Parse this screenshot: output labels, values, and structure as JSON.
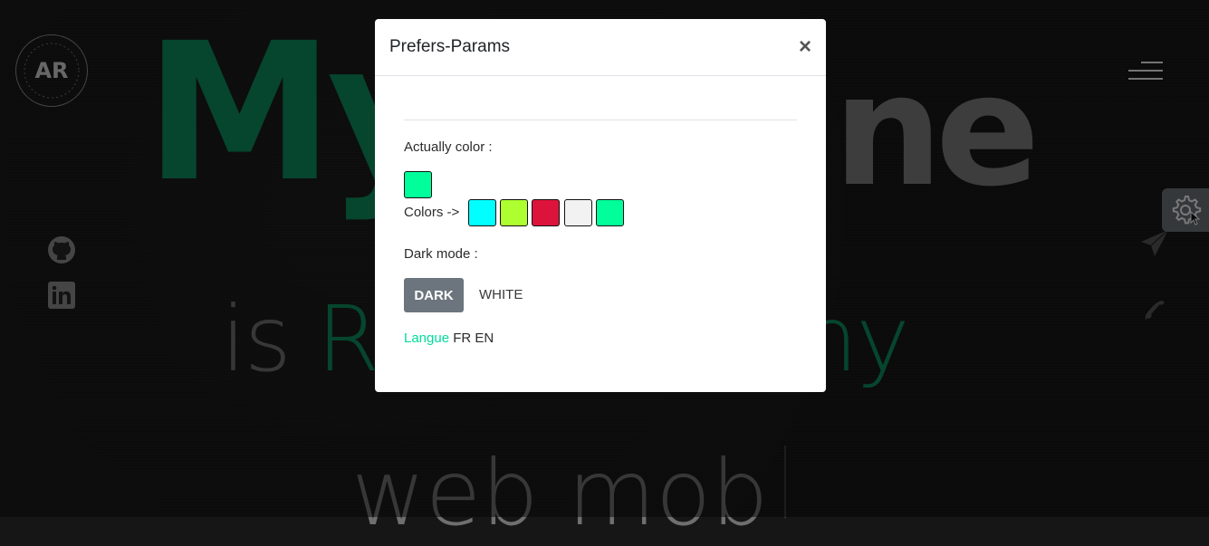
{
  "hero": {
    "line1_colored": "My",
    "line1_gray": "ne",
    "line2_gray": "is ",
    "line2_colored": "R",
    "line2_tail": "ny",
    "line3": "web mob"
  },
  "logo": {
    "initials": "AR"
  },
  "modal": {
    "title": "Prefers-Params",
    "close_symbol": "×",
    "actually_color_label": "Actually color :",
    "current_color": "#00ff9a",
    "colors_label": "Colors ->",
    "colors": [
      "#00ffff",
      "#adff2f",
      "#dc143c",
      "#f2f2f2",
      "#00ff9a"
    ],
    "dark_mode_label": "Dark mode :",
    "dark_button": "DARK",
    "white_button": "WHITE",
    "langue_label": "Langue",
    "lang_fr": "FR",
    "lang_en": "EN"
  },
  "icons": {
    "github": "github-icon",
    "linkedin": "linkedin-icon",
    "send": "paper-plane-icon",
    "phone": "phone-icon",
    "settings": "gear-icon",
    "menu": "hamburger-menu-icon"
  },
  "theme": {
    "accent": "#0c8a5c",
    "accent_bright": "#00dd9a",
    "settings_bg": "#6b7177"
  }
}
